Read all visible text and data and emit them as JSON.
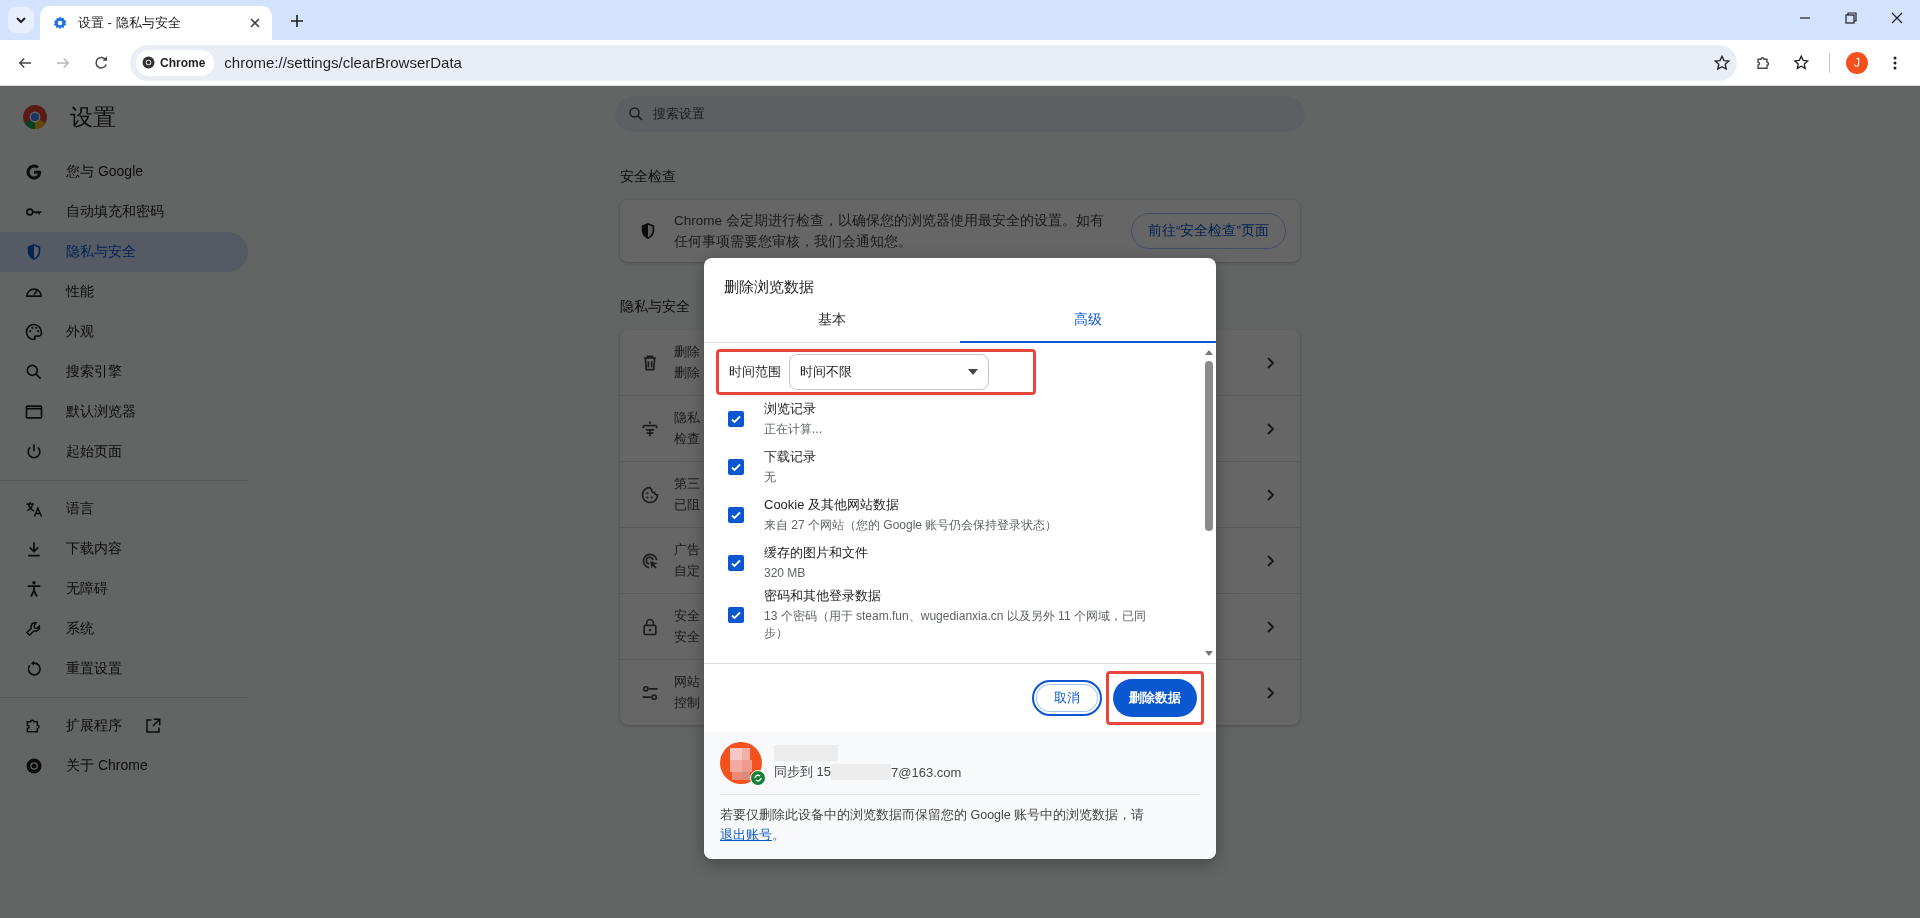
{
  "browser": {
    "tab": {
      "title": "设置 - 隐私与安全"
    },
    "nav_buttons": [
      {
        "kind": "back",
        "disabled": false
      },
      {
        "kind": "forward",
        "disabled": true
      },
      {
        "kind": "reload",
        "disabled": false
      }
    ],
    "omnibox": {
      "chip": "Chrome",
      "url": "chrome://settings/clearBrowserData"
    },
    "profile": {
      "initial": "J"
    }
  },
  "sidebar": {
    "title": "设置",
    "groups": [
      [
        {
          "label": "您与 Google",
          "kind": "g",
          "selected": false
        },
        {
          "label": "自动填充和密码",
          "kind": "key",
          "selected": false
        },
        {
          "label": "隐私与安全",
          "kind": "shield",
          "selected": true
        },
        {
          "label": "性能",
          "kind": "gauge",
          "selected": false
        },
        {
          "label": "外观",
          "kind": "palette",
          "selected": false
        },
        {
          "label": "搜索引擎",
          "kind": "search",
          "selected": false
        },
        {
          "label": "默认浏览器",
          "kind": "window",
          "selected": false
        },
        {
          "label": "起始页面",
          "kind": "power",
          "selected": false
        }
      ],
      [
        {
          "label": "语言",
          "kind": "translate",
          "selected": false
        },
        {
          "label": "下载内容",
          "kind": "download",
          "selected": false
        },
        {
          "label": "无障碍",
          "kind": "person",
          "selected": false
        },
        {
          "label": "系统",
          "kind": "wrench",
          "selected": false
        },
        {
          "label": "重置设置",
          "kind": "reset",
          "selected": false
        }
      ],
      [
        {
          "label": "扩展程序",
          "kind": "puzzle",
          "selected": false,
          "external": true
        },
        {
          "label": "关于 Chrome",
          "kind": "chrome",
          "selected": false,
          "external": false
        }
      ]
    ]
  },
  "search": {
    "placeholder": "搜索设置"
  },
  "safety_check": {
    "heading": "安全检查",
    "text": "Chrome 会定期进行检查，以确保您的浏览器使用最安全的设置。如有任何事项需要您审核，我们会通知您。",
    "button": "前往“安全检查”页面"
  },
  "privacy": {
    "heading": "隐私与安全",
    "rows": [
      {
        "kind": "trash",
        "title": "删除",
        "subtitle": "删除"
      },
      {
        "kind": "guide",
        "title": "隐私",
        "subtitle": "检查"
      },
      {
        "kind": "cookie",
        "title": "第三",
        "subtitle": "已阻"
      },
      {
        "kind": "target",
        "title": "广告",
        "subtitle": "自定"
      },
      {
        "kind": "lock",
        "title": "安全",
        "subtitle": "安全"
      },
      {
        "kind": "sliders",
        "title": "网站",
        "subtitle": "控制"
      }
    ]
  },
  "dialog": {
    "title": "删除浏览数据",
    "tabs": [
      {
        "label": "基本",
        "selected": false
      },
      {
        "label": "高级",
        "selected": true
      }
    ],
    "time_range": {
      "label": "时间范围",
      "value": "时间不限"
    },
    "items": [
      {
        "title": "浏览记录",
        "detail": "正在计算...",
        "checked": true
      },
      {
        "title": "下载记录",
        "detail": "无",
        "checked": true
      },
      {
        "title": "Cookie 及其他网站数据",
        "detail": "来自 27 个网站（您的 Google 账号仍会保持登录状态）",
        "checked": true
      },
      {
        "title": "缓存的图片和文件",
        "detail": "320 MB",
        "checked": true
      },
      {
        "title": "密码和其他登录数据",
        "detail": "13 个密码（用于 steam.fun、wugedianxia.cn 以及另外 11 个网域，已同步）",
        "checked": true
      }
    ],
    "buttons": {
      "cancel": "取消",
      "confirm": "删除数据"
    },
    "account": {
      "sync_prefix": "同步到 15",
      "sync_suffix": "7@163.com"
    },
    "footnote": {
      "text": "若要仅删除此设备中的浏览数据而保留您的 Google 账号中的浏览数据，请",
      "link": "退出账号",
      "end": "。"
    }
  }
}
